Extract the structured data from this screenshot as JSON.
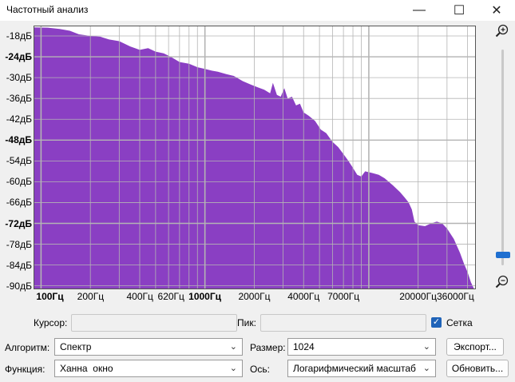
{
  "window": {
    "title": "Частотный анализ",
    "minimize_icon": "minimize-icon",
    "maximize_icon": "maximize-icon",
    "close_icon": "close-icon"
  },
  "plot": {
    "fill_color": "#8a3fc3",
    "grid_color": "#b4b4b4",
    "background": "#ffffff",
    "y_ticks": [
      {
        "label": "-18дБ",
        "value": -18,
        "bold": false
      },
      {
        "label": "-24дБ",
        "value": -24,
        "bold": true
      },
      {
        "label": "-30дБ",
        "value": -30,
        "bold": false
      },
      {
        "label": "-36дБ",
        "value": -36,
        "bold": false
      },
      {
        "label": "-42дБ",
        "value": -42,
        "bold": false
      },
      {
        "label": "-48дБ",
        "value": -48,
        "bold": true
      },
      {
        "label": "-54дБ",
        "value": -54,
        "bold": false
      },
      {
        "label": "-60дБ",
        "value": -60,
        "bold": false
      },
      {
        "label": "-66дБ",
        "value": -66,
        "bold": false
      },
      {
        "label": "-72дБ",
        "value": -72,
        "bold": true
      },
      {
        "label": "-78дБ",
        "value": -78,
        "bold": false
      },
      {
        "label": "-84дБ",
        "value": -84,
        "bold": false
      },
      {
        "label": "-90дБ",
        "value": -90,
        "bold": false
      }
    ],
    "x_ticks": [
      {
        "label": "100Гц",
        "value": 100,
        "bold": true
      },
      {
        "label": "200Гц",
        "value": 200,
        "bold": false
      },
      {
        "label": "400Гц",
        "value": 400,
        "bold": false
      },
      {
        "label": "620Гц",
        "value": 620,
        "bold": false
      },
      {
        "label": "1000Гц",
        "value": 1000,
        "bold": true
      },
      {
        "label": "2000Гц",
        "value": 2000,
        "bold": false
      },
      {
        "label": "4000Гц",
        "value": 4000,
        "bold": false
      },
      {
        "label": "7000Гц",
        "value": 7000,
        "bold": false
      },
      {
        "label": "20000Гц",
        "value": 20000,
        "bold": false
      },
      {
        "label": "36000Гц",
        "value": 36000,
        "bold": false
      }
    ],
    "x_range": [
      90,
      45000
    ],
    "y_range": [
      -15,
      -91
    ],
    "spectrum": [
      [
        90,
        -15.5
      ],
      [
        110,
        -15.6
      ],
      [
        130,
        -16
      ],
      [
        150,
        -16.5
      ],
      [
        170,
        -17.5
      ],
      [
        200,
        -18
      ],
      [
        230,
        -18.2
      ],
      [
        260,
        -19
      ],
      [
        300,
        -19.5
      ],
      [
        350,
        -21
      ],
      [
        400,
        -22
      ],
      [
        450,
        -21.5
      ],
      [
        500,
        -22.5
      ],
      [
        560,
        -23
      ],
      [
        620,
        -24
      ],
      [
        700,
        -25.5
      ],
      [
        800,
        -26
      ],
      [
        900,
        -27
      ],
      [
        1000,
        -27.5
      ],
      [
        1100,
        -28
      ],
      [
        1200,
        -28.3
      ],
      [
        1350,
        -29
      ],
      [
        1500,
        -29.5
      ],
      [
        1700,
        -31
      ],
      [
        1900,
        -32
      ],
      [
        2100,
        -32.8
      ],
      [
        2300,
        -33.5
      ],
      [
        2500,
        -34.5
      ],
      [
        2600,
        -31.5
      ],
      [
        2750,
        -35
      ],
      [
        2900,
        -35.5
      ],
      [
        3050,
        -33
      ],
      [
        3200,
        -36
      ],
      [
        3400,
        -35.5
      ],
      [
        3600,
        -38
      ],
      [
        3800,
        -37.5
      ],
      [
        4000,
        -40
      ],
      [
        4300,
        -41
      ],
      [
        4700,
        -42.5
      ],
      [
        5100,
        -45
      ],
      [
        5500,
        -46
      ],
      [
        6000,
        -48.5
      ],
      [
        6500,
        -50
      ],
      [
        7000,
        -52
      ],
      [
        7500,
        -54
      ],
      [
        8000,
        -56
      ],
      [
        8500,
        -58
      ],
      [
        9000,
        -58.5
      ],
      [
        9500,
        -57
      ],
      [
        10500,
        -57.5
      ],
      [
        11500,
        -58
      ],
      [
        12500,
        -59
      ],
      [
        14000,
        -61
      ],
      [
        15500,
        -63
      ],
      [
        16500,
        -64.5
      ],
      [
        17500,
        -66
      ],
      [
        18300,
        -68
      ],
      [
        19000,
        -71.5
      ],
      [
        20000,
        -72.5
      ],
      [
        22000,
        -72.8
      ],
      [
        24000,
        -72
      ],
      [
        26000,
        -71.5
      ],
      [
        28000,
        -72
      ],
      [
        30000,
        -73.5
      ],
      [
        33000,
        -76.5
      ],
      [
        36000,
        -80.5
      ],
      [
        38000,
        -83.5
      ],
      [
        40000,
        -86
      ],
      [
        42000,
        -89
      ],
      [
        44000,
        -91
      ]
    ]
  },
  "zoom": {
    "zoom_in_icon": "zoom-in-icon",
    "zoom_out_icon": "zoom-out-icon",
    "slider_level": 0.95
  },
  "controls": {
    "cursor_label": "Курсор:",
    "cursor_value": "",
    "peak_label": "Пик:",
    "peak_value": "",
    "grid_label": "Сетка",
    "grid_checked": true,
    "algorithm_label": "Алгоритм:",
    "algorithm_value": "Спектр",
    "size_label": "Размер:",
    "size_value": "1024",
    "export_button": "Экспорт...",
    "function_label": "Функция:",
    "function_value": "Ханна  окно",
    "axis_label": "Ось:",
    "axis_value": "Логарифмический масштаб",
    "refresh_button": "Обновить..."
  }
}
